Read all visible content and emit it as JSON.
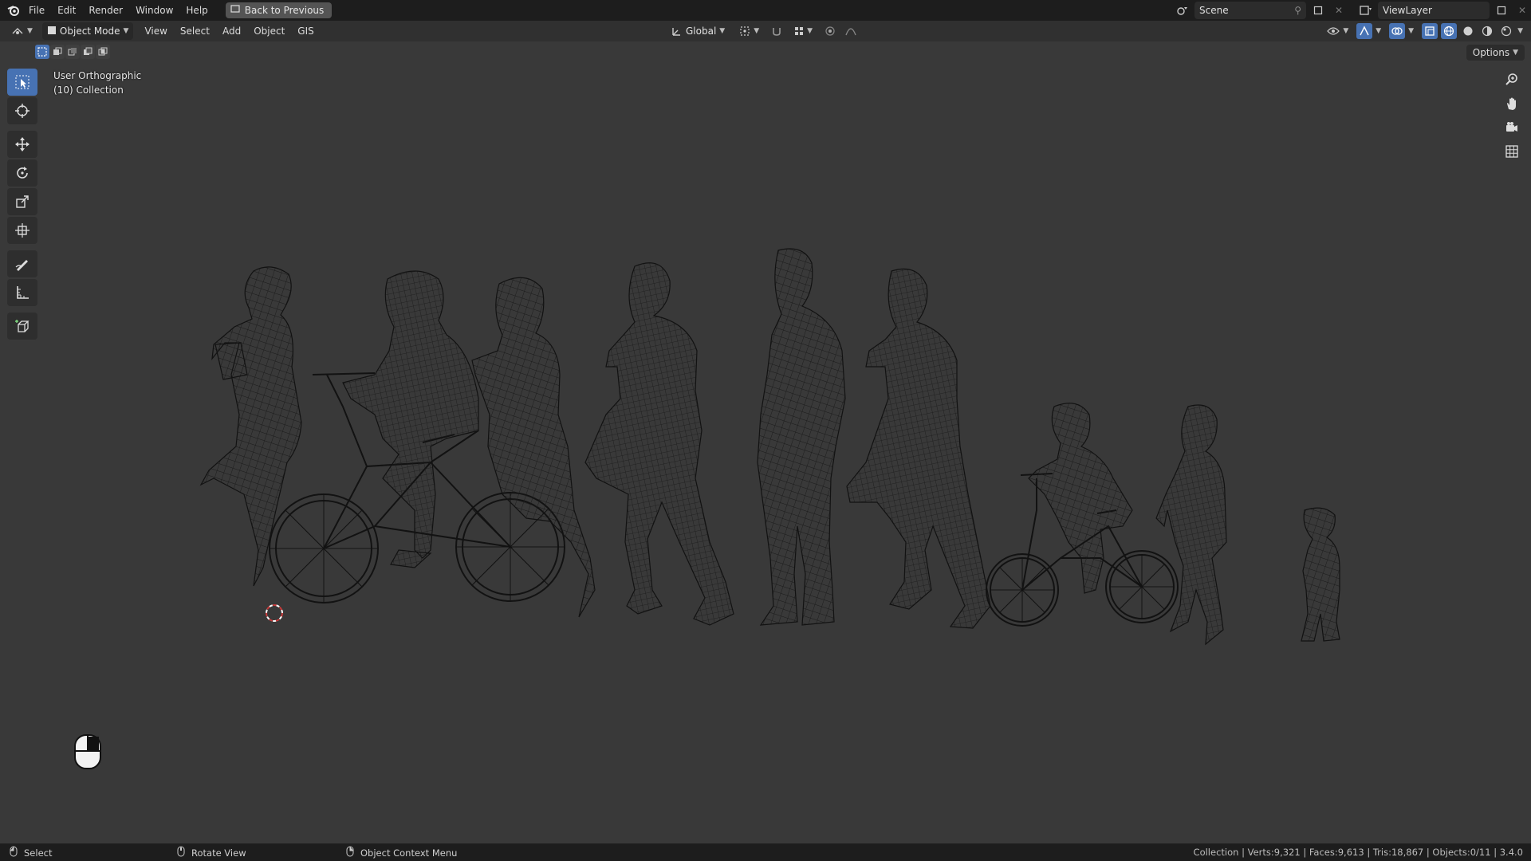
{
  "menubar": {
    "items": [
      "File",
      "Edit",
      "Render",
      "Window",
      "Help"
    ],
    "back_button": "Back to Previous",
    "scene": "Scene",
    "view_layer": "ViewLayer"
  },
  "viewport_header": {
    "mode": "Object Mode",
    "menus": [
      "View",
      "Select",
      "Add",
      "Object",
      "GIS"
    ],
    "transform_orientation": "Global",
    "options": "Options"
  },
  "viewport": {
    "view_name": "User Orthographic",
    "collection": "(10) Collection"
  },
  "statusbar": {
    "left_action": "Select",
    "middle_action": "Rotate View",
    "right_action": "Object Context Menu",
    "stats": "Collection | Verts:9,321 | Faces:9,613 | Tris:18,867 | Objects:0/11 | 3.4.0"
  },
  "colors": {
    "accent": "#4772b3",
    "wire": "#0e0e0e",
    "background": "#393939"
  }
}
